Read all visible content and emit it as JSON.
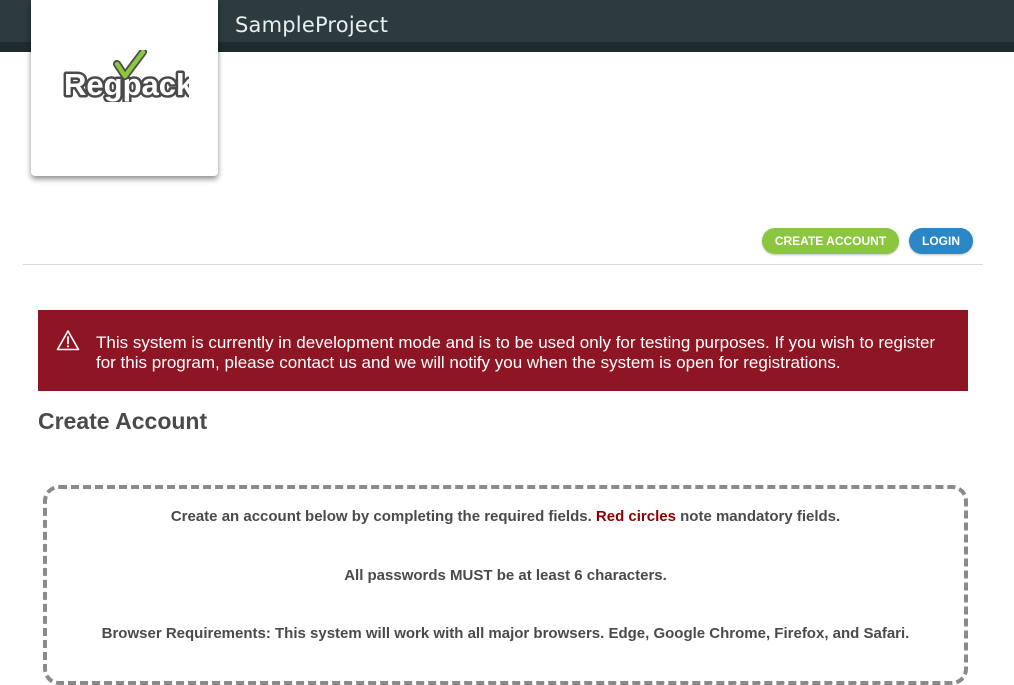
{
  "header": {
    "project_title": "SampleProject",
    "logo_text": "Regpack"
  },
  "nav": {
    "create_account_label": "CREATE ACCOUNT",
    "login_label": "LOGIN"
  },
  "alert": {
    "icon": "warning-triangle-icon",
    "message": "This system is currently in development mode and is to be used only for testing purposes. If you wish to register for this program, please contact us and we will notify you when the system is open for registrations."
  },
  "main": {
    "title": "Create Account",
    "intro_prefix": "Create an account below by completing the required fields.",
    "intro_highlight": "Red circles",
    "intro_suffix": "note mandatory fields.",
    "password_note": "All passwords MUST be at least 6 characters.",
    "browser_requirements": "Browser Requirements: This system will work with all major browsers. Edge, Google Chrome, Firefox, and Safari."
  },
  "colors": {
    "header_bg": "#2b3b3e",
    "create_button": "#8cc63f",
    "login_button": "#2a86c4",
    "alert_bg": "#8e1624",
    "highlight_red": "#8b0000"
  }
}
